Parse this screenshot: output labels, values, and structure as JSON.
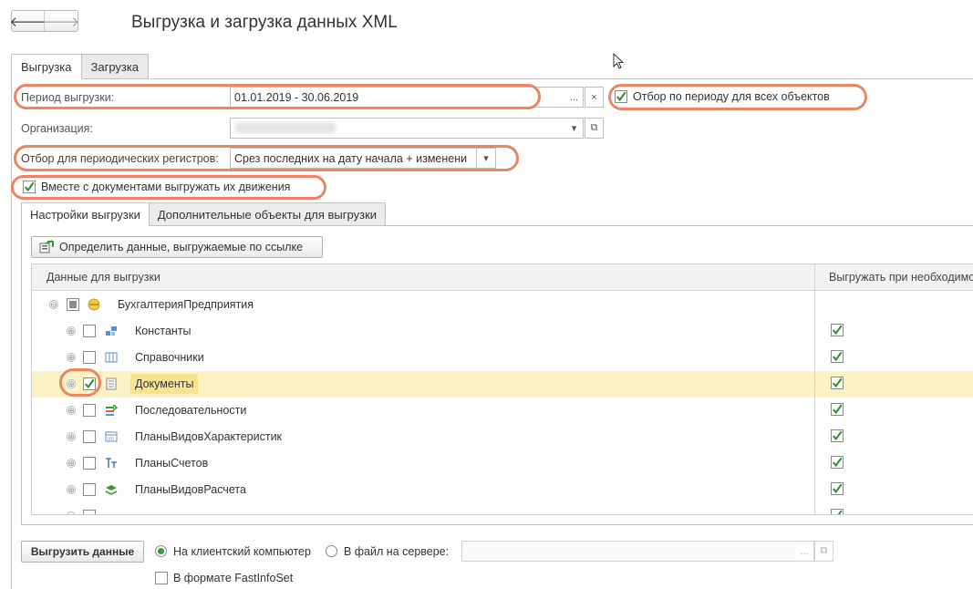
{
  "window": {
    "title": "Выгрузка и загрузка данных XML",
    "back_glyph": "🡐",
    "forward_glyph": "🡒"
  },
  "tabs": [
    {
      "label": "Выгрузка",
      "active": true
    },
    {
      "label": "Загрузка",
      "active": false
    }
  ],
  "form": {
    "period_label": "Период выгрузки:",
    "period_value": "01.01.2019 - 30.06.2019",
    "period_select_glyph": "...",
    "period_clear_glyph": "×",
    "period_filter_label": "Отбор по периоду для всех объектов",
    "period_filter_checked": true,
    "org_label": "Организация:",
    "org_value": "",
    "org_dropdown_glyph": "▾",
    "org_open_glyph": "⧉",
    "periodic_label": "Отбор для периодических регистров:",
    "periodic_value": "Срез последних на дату начала + изменени",
    "periodic_dropdown_glyph": "▾",
    "with_movements_label": "Вместе с документами выгружать их движения",
    "with_movements_checked": true
  },
  "inner_tabs": [
    {
      "label": "Настройки выгрузки",
      "active": true
    },
    {
      "label": "Дополнительные объекты для выгрузки",
      "active": false
    }
  ],
  "define_button_label": "Определить данные, выгружаемые по ссылке",
  "table": {
    "columns": [
      "Данные для выгрузки",
      "Выгружать при необходимо"
    ],
    "root": {
      "label": "БухгалтерияПредприятия",
      "expand_glyph": "⊖"
    },
    "rows": [
      {
        "label": "Константы",
        "icon": "constants-icon",
        "checked": false,
        "export_if_needed": true,
        "expand_glyph": "⊕"
      },
      {
        "label": "Справочники",
        "icon": "catalogs-icon",
        "checked": false,
        "export_if_needed": true,
        "expand_glyph": "⊕"
      },
      {
        "label": "Документы",
        "icon": "documents-icon",
        "checked": true,
        "export_if_needed": true,
        "selected": true,
        "expand_glyph": "⊕"
      },
      {
        "label": "Последовательности",
        "icon": "sequences-icon",
        "checked": false,
        "export_if_needed": true,
        "expand_glyph": "⊕"
      },
      {
        "label": "ПланыВидовХарактеристик",
        "icon": "characteristic-types-icon",
        "checked": false,
        "export_if_needed": true,
        "expand_glyph": "⊕"
      },
      {
        "label": "ПланыСчетов",
        "icon": "chart-of-accounts-icon",
        "checked": false,
        "export_if_needed": true,
        "expand_glyph": "⊕"
      },
      {
        "label": "ПланыВидовРасчета",
        "icon": "calculation-types-icon",
        "checked": false,
        "export_if_needed": true,
        "expand_glyph": "⊕"
      }
    ]
  },
  "bottom": {
    "export_button": "Выгрузить данные",
    "radio_client_label": "На клиентский компьютер",
    "radio_server_label": "В файл на сервере:",
    "client_selected": true,
    "server_file_value": "",
    "server_select_glyph": "...",
    "server_open_glyph": "⧉",
    "fastinfoset_label": "В формате FastInfoSet",
    "fastinfoset_checked": false
  },
  "colors": {
    "accent_check": "#2f8f2f",
    "highlight_oval": "#ec8560",
    "selected_row": "#fbf2c6"
  }
}
